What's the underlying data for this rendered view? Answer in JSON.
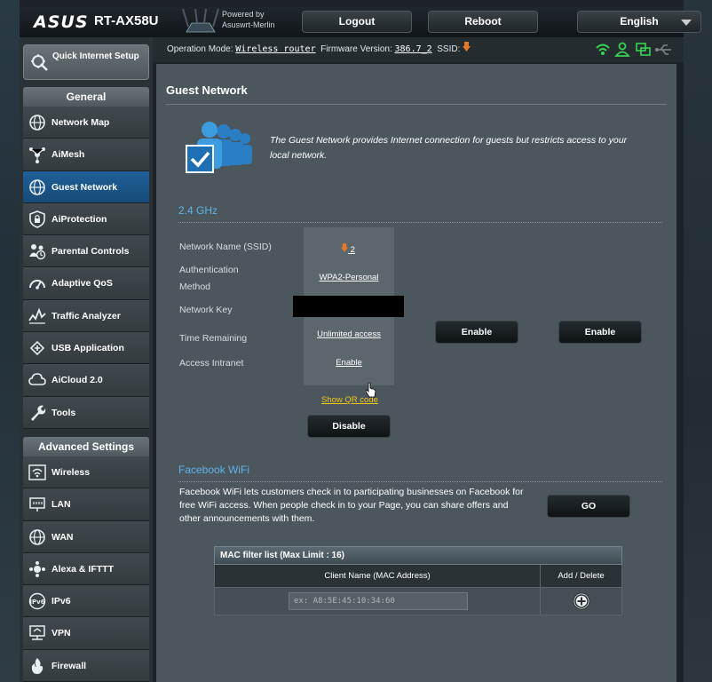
{
  "header": {
    "brand": "ASUS",
    "model": "RT-AX58U",
    "powered_line1": "Powered by",
    "powered_line2": "Asuswrt-Merlin",
    "logout_label": "Logout",
    "reboot_label": "Reboot",
    "language": "English"
  },
  "status": {
    "op_mode_label": "Operation Mode:",
    "op_mode_value": "Wireless router",
    "fw_label": "Firmware Version:",
    "fw_value": "386.7_2",
    "ssid_label": "SSID:",
    "icons": [
      "wifi-icon",
      "user-icon",
      "network-icon",
      "usb-icon"
    ],
    "icon_color": "#39d353"
  },
  "sidebar": {
    "quick_setup": "Quick Internet Setup",
    "general_header": "General",
    "general_items": [
      {
        "label": "Network Map",
        "icon": "globe-icon"
      },
      {
        "label": "AiMesh",
        "icon": "mesh-icon"
      },
      {
        "label": "Guest Network",
        "icon": "guest-globe-icon",
        "active": true
      },
      {
        "label": "AiProtection",
        "icon": "shield-lock-icon"
      },
      {
        "label": "Parental Controls",
        "icon": "family-icon"
      },
      {
        "label": "Adaptive QoS",
        "icon": "gauge-icon"
      },
      {
        "label": "Traffic Analyzer",
        "icon": "chart-icon"
      },
      {
        "label": "USB Application",
        "icon": "usb-puzzle-icon"
      },
      {
        "label": "AiCloud 2.0",
        "icon": "cloud-icon"
      },
      {
        "label": "Tools",
        "icon": "wrench-icon"
      }
    ],
    "advanced_header": "Advanced Settings",
    "advanced_items": [
      {
        "label": "Wireless",
        "icon": "wireless-icon"
      },
      {
        "label": "LAN",
        "icon": "lan-icon"
      },
      {
        "label": "WAN",
        "icon": "wan-globe-icon"
      },
      {
        "label": "Alexa & IFTTT",
        "icon": "alexa-icon"
      },
      {
        "label": "IPv6",
        "icon": "ipv6-icon"
      },
      {
        "label": "VPN",
        "icon": "vpn-icon"
      },
      {
        "label": "Firewall",
        "icon": "firewall-icon"
      }
    ]
  },
  "main": {
    "title": "Guest Network",
    "description": "The Guest Network provides Internet connection for guests but restricts access to your local network.",
    "band_header": "2.4 GHz",
    "fields": {
      "ssid_label": "Network Name (SSID)",
      "auth_label_1": "Authentication",
      "auth_label_2": "Method",
      "key_label": "Network Key",
      "time_label": "Time Remaining",
      "intranet_label": "Access Intranet"
    },
    "guest1": {
      "ssid": "2",
      "auth": "WPA2-Personal",
      "time": "Unlimited access",
      "intranet": "Enable",
      "qr": "Show QR code",
      "disable_label": "Disable"
    },
    "enable_label": "Enable",
    "facebook": {
      "header": "Facebook WiFi",
      "description": "Facebook WiFi lets customers check in to participating businesses on Facebook for free WiFi access. When people check in to your Page, you can share offers and other announcements with them.",
      "go_label": "GO"
    },
    "mac_table": {
      "title": "MAC filter list (Max Limit : 16)",
      "col_client": "Client Name (MAC Address)",
      "col_action": "Add / Delete",
      "placeholder": "ex: A8:5E:45:10:34:60"
    }
  }
}
